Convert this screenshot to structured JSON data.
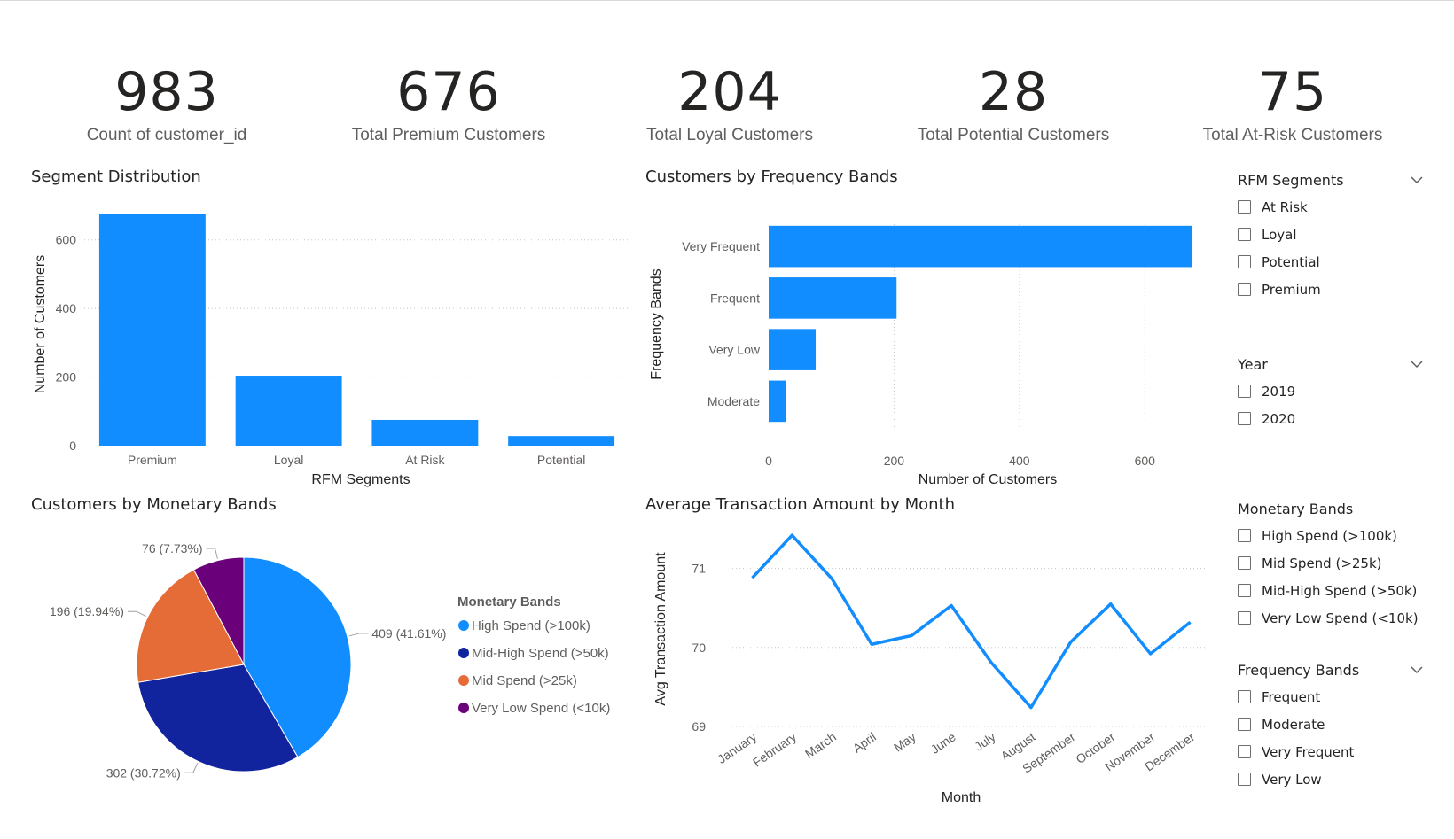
{
  "kpis": [
    {
      "value": "983",
      "label": "Count of customer_id"
    },
    {
      "value": "676",
      "label": "Total Premium Customers"
    },
    {
      "value": "204",
      "label": "Total Loyal Customers"
    },
    {
      "value": "28",
      "label": "Total Potential Customers"
    },
    {
      "value": "75",
      "label": "Total At-Risk Customers"
    }
  ],
  "colors": {
    "bar": "#118DFF",
    "pie": [
      "#118DFF",
      "#12239E",
      "#E66C37",
      "#6B007B"
    ],
    "text": "#252423",
    "axis": "#605e5c"
  },
  "icons": {
    "chevron": "chevron-down-icon",
    "checkbox": "checkbox-icon"
  },
  "chart_data": [
    {
      "type": "bar",
      "title": "Segment Distribution",
      "xlabel": "RFM Segments",
      "ylabel": "Number of Customers",
      "categories": [
        "Premium",
        "Loyal",
        "At Risk",
        "Potential"
      ],
      "values": [
        676,
        204,
        75,
        28
      ],
      "yticks": [
        "0",
        "200",
        "400",
        "600"
      ],
      "ylim": [
        0,
        700
      ],
      "grid": true
    },
    {
      "type": "bar",
      "orientation": "horizontal",
      "title": "Customers by Frequency Bands",
      "xlabel": "Number of Customers",
      "ylabel": "Frequency Bands",
      "categories": [
        "Very Frequent",
        "Frequent",
        "Very Low",
        "Moderate"
      ],
      "values": [
        676,
        204,
        75,
        28
      ],
      "xticks": [
        "0",
        "200",
        "400",
        "600"
      ],
      "xlim": [
        0,
        700
      ],
      "grid": true
    },
    {
      "type": "pie",
      "title": "Customers by Monetary Bands",
      "legend_title": "Monetary Bands",
      "legend_position": "right",
      "slices": [
        {
          "name": "High Spend (>100k)",
          "value": 409,
          "label": "409 (41.61%)"
        },
        {
          "name": "Mid-High Spend (>50k)",
          "value": 302,
          "label": "302 (30.72%)"
        },
        {
          "name": "Mid Spend (>25k)",
          "value": 196,
          "label": "196 (19.94%)"
        },
        {
          "name": "Very Low Spend (<10k)",
          "value": 76,
          "label": "76 (7.73%)"
        }
      ]
    },
    {
      "type": "line",
      "title": "Average Transaction Amount by Month",
      "xlabel": "Month",
      "ylabel": "Avg Transaction Amount",
      "categories": [
        "January",
        "February",
        "March",
        "April",
        "May",
        "June",
        "July",
        "August",
        "September",
        "October",
        "November",
        "December"
      ],
      "values": [
        70.88,
        71.42,
        70.87,
        70.04,
        70.15,
        70.53,
        69.81,
        69.24,
        70.07,
        70.55,
        69.92,
        70.32
      ],
      "yticks": [
        "69",
        "70",
        "71"
      ],
      "ylim": [
        69,
        71.5
      ],
      "grid": true
    }
  ],
  "slicers": [
    {
      "title": "RFM Segments",
      "items": [
        "At Risk",
        "Loyal",
        "Potential",
        "Premium"
      ],
      "has_chevron": true
    },
    {
      "title": "Year",
      "items": [
        "2019",
        "2020"
      ],
      "has_chevron": true
    },
    {
      "title": "Monetary Bands",
      "items": [
        "High Spend (>100k)",
        "Mid Spend (>25k)",
        "Mid-High Spend (>50k)",
        "Very Low Spend (<10k)"
      ],
      "has_chevron": false
    },
    {
      "title": "Frequency Bands",
      "items": [
        "Frequent",
        "Moderate",
        "Very Frequent",
        "Very Low"
      ],
      "has_chevron": true
    }
  ]
}
